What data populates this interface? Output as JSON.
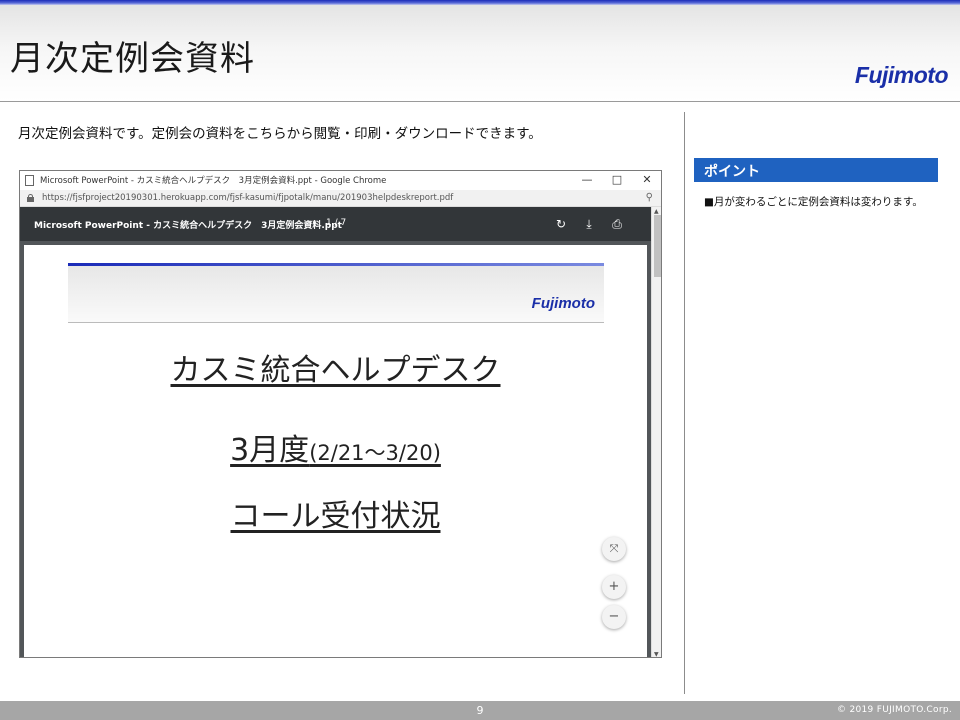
{
  "slide": {
    "title": "月次定例会資料",
    "logo": "Fujimoto",
    "intro": "月次定例会資料です。定例会の資料をこちらから閲覧・印刷・ダウンロードできます。"
  },
  "point": {
    "header": "ポイント",
    "text": "■月が変わるごとに定例会資料は変わります。"
  },
  "browser": {
    "window_title": "Microsoft PowerPoint - カスミ統合ヘルプデスク　3月定例会資料.ppt - Google Chrome",
    "minimize": "—",
    "maximize": "□",
    "close": "✕",
    "url": "https://fjsfproject20190301.herokuapp.com/fjsf-kasumi/fjpotalk/manu/201903helpdeskreport.pdf",
    "zoom_icon": "⚲"
  },
  "viewer": {
    "doc_title": "Microsoft PowerPoint - カスミ統合ヘルプデスク　3月定例会資料.ppt",
    "page_count": "1 / 7",
    "rotate_icon": "↻",
    "download_icon": "⤓",
    "print_icon": "⎙",
    "fit_icon": "⤧",
    "zoom_in": "+",
    "zoom_out": "−"
  },
  "pdf": {
    "logo": "Fujimoto",
    "title": "カスミ統合ヘルプデスク",
    "month": "3月度",
    "range": "(2/21～3/20)",
    "subtitle": "コール受付状況"
  },
  "footer": {
    "page_number": "9",
    "copyright": "© 2019 FUJIMOTO.Corp."
  }
}
